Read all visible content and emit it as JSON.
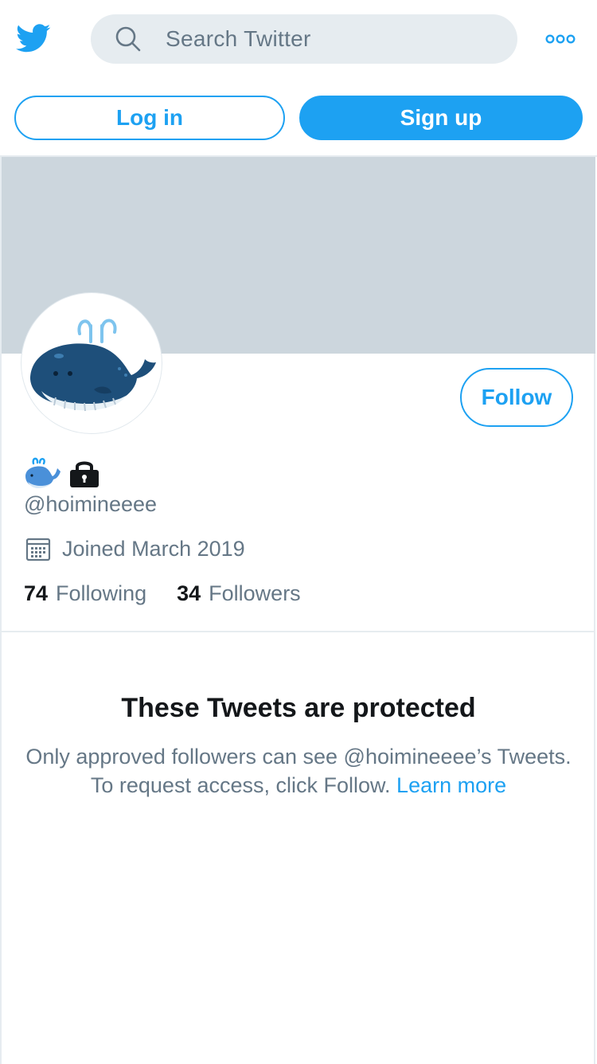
{
  "header": {
    "logo_icon": "twitter-bird-icon",
    "search_icon": "search-icon",
    "search_placeholder": "Search Twitter",
    "more_icon": "more-dots-icon",
    "login_label": "Log in",
    "signup_label": "Sign up"
  },
  "profile": {
    "banner_color": "#ccd6dd",
    "avatar_icon": "whale-avatar",
    "follow_label": "Follow",
    "name_icons": [
      "whale-emoji-icon",
      "lock-icon"
    ],
    "handle": "@hoimineeee",
    "calendar_icon": "calendar-icon",
    "joined": "Joined March 2019",
    "following_count": "74",
    "following_label": "Following",
    "followers_count": "34",
    "followers_label": "Followers"
  },
  "protected": {
    "title": "These Tweets are protected",
    "body": "Only approved followers can see @hoimineeee’s Tweets. To request access, click Follow.",
    "learn_more": "Learn more"
  },
  "colors": {
    "accent": "#1da1f2",
    "secondary_text": "#657786",
    "primary_text": "#14171a",
    "search_bg": "#e6ecf0"
  }
}
